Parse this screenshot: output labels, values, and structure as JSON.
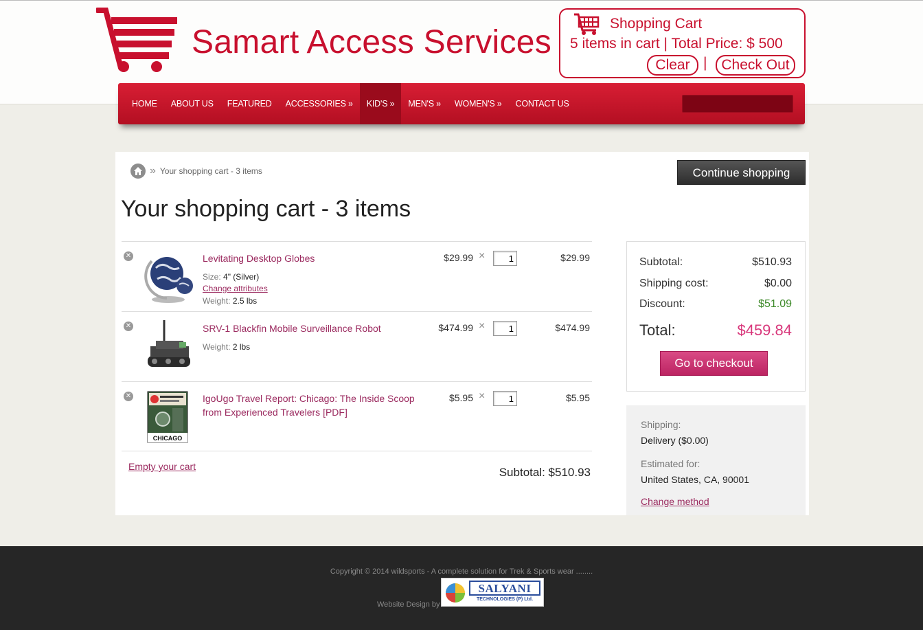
{
  "header": {
    "site_title": "Samart Access Services",
    "accent_color": "#c8102e",
    "mini_cart": {
      "title": "Shopping Cart",
      "summary": "5 items in cart | Total Price: $ 500",
      "clear_label": "Clear",
      "separator": "|",
      "checkout_label": "Check Out"
    }
  },
  "nav": {
    "items": [
      {
        "label": "HOME"
      },
      {
        "label": "ABOUT US"
      },
      {
        "label": "FEATURED"
      },
      {
        "label": "ACCESSORIES »"
      },
      {
        "label": "KID'S »"
      },
      {
        "label": "MEN'S »"
      },
      {
        "label": "WOMEN'S »"
      },
      {
        "label": "CONTACT US"
      }
    ],
    "active_index": 4,
    "search_placeholder": ""
  },
  "breadcrumb": {
    "home_icon": "home-icon",
    "separator": "»",
    "current": "Your shopping cart - 3 items"
  },
  "continue_label": "Continue shopping",
  "page_title": "Your shopping cart - 3 items",
  "cart": {
    "items": [
      {
        "name": "Levitating Desktop Globes",
        "size_label": "Size:",
        "size_value": "4\" (Silver)",
        "change_label": "Change attributes",
        "weight_label": "Weight:",
        "weight_value": "2.5 lbs",
        "price": "$29.99",
        "times": "×",
        "qty": "1",
        "total": "$29.99"
      },
      {
        "name": "SRV-1 Blackfin Mobile Surveillance Robot",
        "weight_label": "Weight:",
        "weight_value": "2 lbs",
        "price": "$474.99",
        "times": "×",
        "qty": "1",
        "total": "$474.99"
      },
      {
        "name": "IgoUgo Travel Report: Chicago: The Inside Scoop from Experienced Travelers [PDF]",
        "thumb_caption": "CHICAGO",
        "price": "$5.95",
        "times": "×",
        "qty": "1",
        "total": "$5.95"
      }
    ],
    "empty_label": "Empty your cart",
    "subtotal_text": "Subtotal: $510.93"
  },
  "summary": {
    "subtotal_label": "Subtotal:",
    "subtotal_value": "$510.93",
    "shipping_label": "Shipping cost:",
    "shipping_value": "$0.00",
    "discount_label": "Discount:",
    "discount_value": "$51.09",
    "total_label": "Total:",
    "total_value": "$459.84",
    "checkout_label": "Go to checkout",
    "total_color": "#d8367a",
    "discount_color": "#3e8a2a"
  },
  "shipping": {
    "shipping_label": "Shipping:",
    "shipping_value": "Delivery ($0.00)",
    "estimated_label": "Estimated for:",
    "estimated_value": "United States, CA, 90001",
    "change_label": "Change method"
  },
  "footer": {
    "copyright": "Copyright © 2014 wildsports - A complete solution for Trek & Sports wear ........",
    "design_by": "Website Design by",
    "partner_name": "SALYANI",
    "partner_sub": "TECHNOLOGIES (P) Ltd."
  }
}
